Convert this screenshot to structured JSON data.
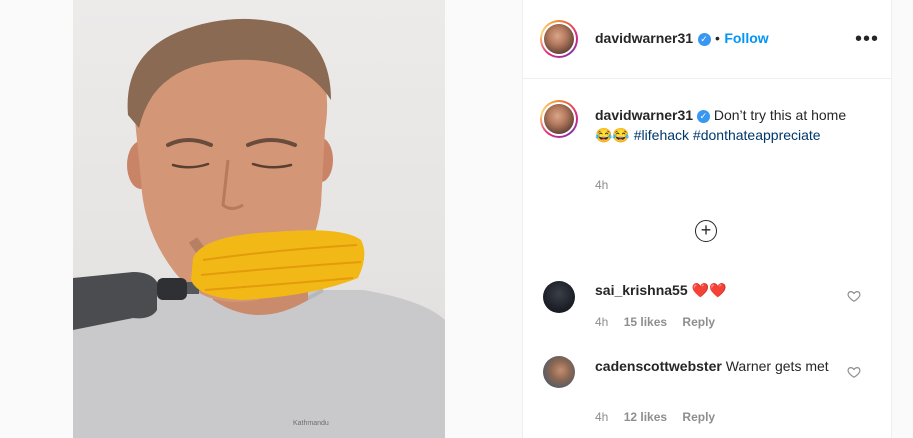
{
  "post": {
    "author": "davidwarner31",
    "follow_label": "Follow",
    "separator": "•",
    "more_label": "•••",
    "caption": {
      "author": "davidwarner31",
      "text": "Don’t try this at home",
      "emojis": "😂😂",
      "hashtags": [
        "#lifehack",
        "#donthateappreciate"
      ],
      "time": "4h"
    },
    "load_more_symbol": "+"
  },
  "comments": [
    {
      "username": "sai_krishna55",
      "text": "",
      "emojis": "❤️❤️",
      "time": "4h",
      "likes": "15 likes",
      "reply": "Reply"
    },
    {
      "username": "cadenscottwebster",
      "text": "Warner gets met",
      "emojis": "",
      "time": "4h",
      "likes": "12 likes",
      "reply": "Reply"
    }
  ],
  "colors": {
    "link": "#0095f6",
    "hashtag": "#00376b",
    "muted": "#8e8e8e",
    "heart": "#e0245e"
  },
  "icons": {
    "more": "ellipsis-horizontal-icon",
    "verified": "verified-badge-icon",
    "load_more": "plus-circle-icon",
    "like": "heart-outline-icon"
  }
}
